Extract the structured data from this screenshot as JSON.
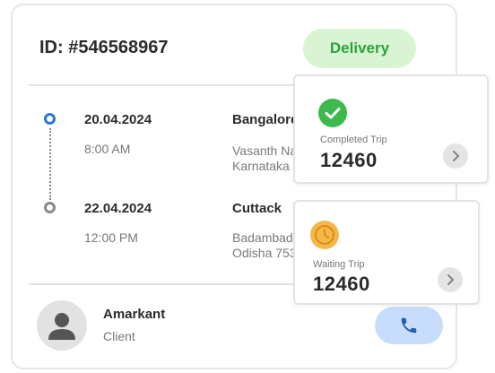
{
  "order": {
    "id_label": "ID: #546568967",
    "status": "Delivery"
  },
  "timeline": [
    {
      "date": "20.04.2024",
      "time": "8:00 AM",
      "city": "Bangalore",
      "address_line1": "Vasanth Nagar",
      "address_line2": "Karnataka"
    },
    {
      "date": "22.04.2024",
      "time": "12:00 PM",
      "city": "Cuttack",
      "address_line1": "Badambadi",
      "address_line2": "Odisha 753"
    }
  ],
  "client": {
    "name": "Amarkant",
    "role": "Client"
  },
  "stats": [
    {
      "label": "Completed Trip",
      "value": "12460",
      "icon": "check-circle-icon",
      "color": "#3dba4e"
    },
    {
      "label": "Waiting Trip",
      "value": "12460",
      "icon": "clock-icon",
      "color": "#f3b84a"
    }
  ],
  "colors": {
    "accent_blue": "#2f78d0",
    "delivery_green": "#29a33a",
    "delivery_bg": "#d9f4d3",
    "call_bg": "#c7ddfb"
  }
}
